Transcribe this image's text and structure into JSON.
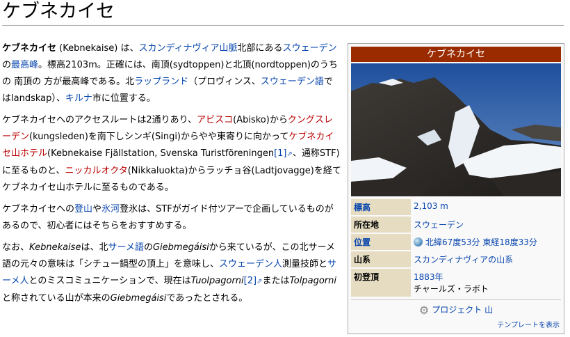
{
  "title": "ケブネカイセ",
  "article": {
    "p1": {
      "bold": "ケブネカイセ",
      "t1": " (Kebnekaise) は、",
      "l_scand": "スカンディナヴィア山脈",
      "t2": "北部にある",
      "l_sweden": "スウェーデン",
      "t3": "の",
      "l_highest": "最高峰",
      "t4": "。標高2103m。正確には、南頂(sydtoppen)と北頂(nordtoppen)のうちの 南頂の 方が最高峰である。北",
      "l_lapland": "ラップランド",
      "t5": "（プロヴィンス、",
      "l_swedish": "スウェーデン語",
      "t6": "ではlandskap）、",
      "l_kiruna": "キルナ",
      "t7": "市に位置する。"
    },
    "p2": {
      "t1": "ケブネカイセへのアクセスルートは2通りあり、",
      "l_abisko": "アビスコ",
      "t2": "(Abisko)から",
      "l_kungsleden": "クングスレーデン",
      "t3": "(kungsleden)を南下しシンギ(Singi)からやや東寄りに向かって",
      "l_hotel": "ケブネカイセ山ホテル",
      "t4": "(Kebnekaise Fjällstation, Svenska Turistföreningen",
      "ref1": "[1]",
      "t5": "、通称STF)に至るものと、",
      "l_nikka": "ニッカルオクタ",
      "t6": "(Nikkaluokta)からラッチョ谷(Ladtjovagge)を経てケブネカイセ山ホテルに至るものである。"
    },
    "p3": {
      "t1": "ケブネカイセへの",
      "l_climb": "登山",
      "t2": "や",
      "l_glacier": "氷河",
      "t3": "登氷は、STFがガイド付ツアーで企画しているものがあるので、初心者にはそちらをおすすめする。"
    },
    "p4": {
      "t1": "なお、",
      "i_keb": "Kebnekaise",
      "t2": "は、北",
      "l_sami": "サーメ語",
      "t3": "の",
      "i_gieb": "Giebmegáisi",
      "t4": "から来ているが、この北サーメ語の元々の意味は「シチュー鍋型の頂上」を意味し、",
      "l_swedes": "スウェーデン人",
      "t5": "測量技師と",
      "l_sami_people": "サーメ人",
      "t6": "とのミスコミュニケーションで、現在は",
      "i_tuol": "Tuolpagorni",
      "ref2": "[2]",
      "t7": "または",
      "i_tolp": "Tolpagorni",
      "t8": "と称されている山が本来の",
      "i_gieb2": "Giebmegáisi",
      "t9": "であったとされる。"
    }
  },
  "infobox": {
    "header": "ケブネカイセ",
    "rows": [
      {
        "label": "標高",
        "value": "2,103 m"
      },
      {
        "label": "所在地",
        "value": "スウェーデン"
      },
      {
        "label": "位置",
        "value": "北緯67度53分 東経18度33分"
      },
      {
        "label": "山系",
        "value": "スカンディナヴィアの山系"
      },
      {
        "label": "初登頂",
        "value": "1883年",
        "value2": "チャールズ・ラボト"
      }
    ],
    "project": "プロジェクト 山",
    "template_link": "テンプレートを表示"
  },
  "colors": {
    "header_bg": "#9a2b00",
    "label_bg": "#e5dcc2",
    "link": "#0645ad",
    "redlink": "#ba0000"
  },
  "icons": {
    "globe": "globe-icon",
    "project": "gear-icon",
    "external": "external-link-icon"
  }
}
